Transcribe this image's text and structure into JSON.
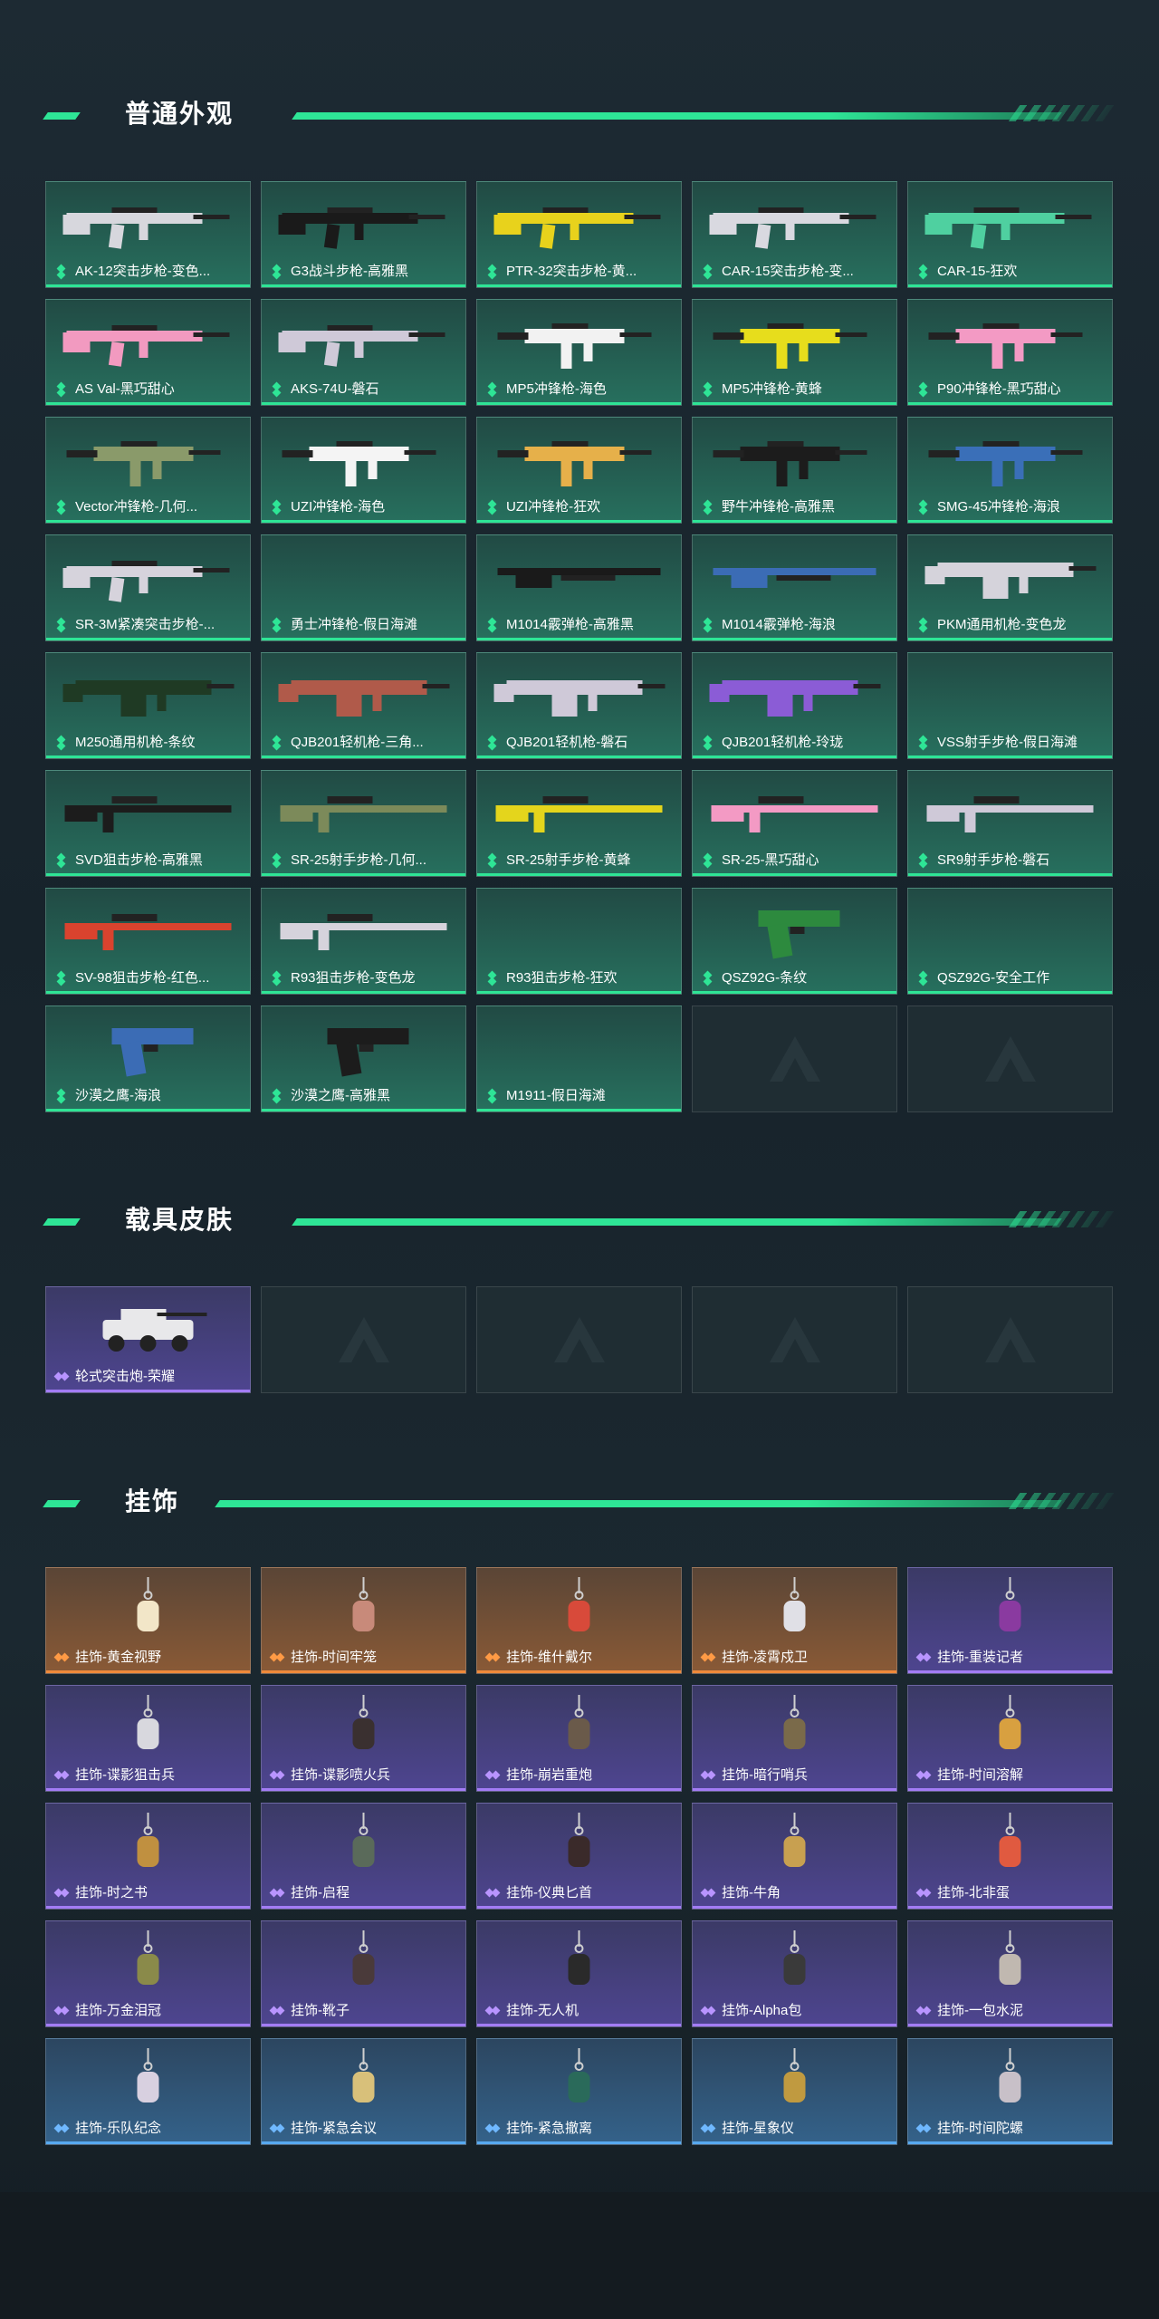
{
  "sections": {
    "weapons": {
      "title": "普通外观",
      "items": [
        {
          "label": "AK-12突击步枪-变色...",
          "quality": "green",
          "icon": "rifle-icon",
          "color": "#d7d7dd"
        },
        {
          "label": "G3战斗步枪-高雅黑",
          "quality": "green",
          "icon": "rifle-icon",
          "color": "#1a1a1a"
        },
        {
          "label": "PTR-32突击步枪-黄...",
          "quality": "green",
          "icon": "rifle-icon",
          "color": "#e8d21c"
        },
        {
          "label": "CAR-15突击步枪-变...",
          "quality": "green",
          "icon": "rifle-icon",
          "color": "#d9d9e0"
        },
        {
          "label": "CAR-15-狂欢",
          "quality": "green",
          "icon": "rifle-icon",
          "color": "#4fd0a0"
        },
        {
          "label": "AS Val-黑巧甜心",
          "quality": "green",
          "icon": "rifle-icon",
          "color": "#f29ac0"
        },
        {
          "label": "AKS-74U-磐石",
          "quality": "green",
          "icon": "rifle-icon",
          "color": "#cfc9d8"
        },
        {
          "label": "MP5冲锋枪-海色",
          "quality": "green",
          "icon": "smg-icon",
          "color": "#f2f2f2"
        },
        {
          "label": "MP5冲锋枪-黄蜂",
          "quality": "green",
          "icon": "smg-icon",
          "color": "#e7dd1c"
        },
        {
          "label": "P90冲锋枪-黑巧甜心",
          "quality": "green",
          "icon": "smg-icon",
          "color": "#f39ac4"
        },
        {
          "label": "Vector冲锋枪-几何...",
          "quality": "green",
          "icon": "smg-icon",
          "color": "#8a9a6a"
        },
        {
          "label": "UZI冲锋枪-海色",
          "quality": "green",
          "icon": "smg-icon",
          "color": "#f4f4f4"
        },
        {
          "label": "UZI冲锋枪-狂欢",
          "quality": "green",
          "icon": "smg-icon",
          "color": "#e6b04a"
        },
        {
          "label": "野牛冲锋枪-高雅黑",
          "quality": "green",
          "icon": "smg-icon",
          "color": "#1c1c1c"
        },
        {
          "label": "SMG-45冲锋枪-海浪",
          "quality": "green",
          "icon": "smg-icon",
          "color": "#3a6fb8"
        },
        {
          "label": "SR-3M紧凑突击步枪-...",
          "quality": "green",
          "icon": "rifle-icon",
          "color": "#d6d3dc"
        },
        {
          "label": "勇士冲锋枪-假日海滩",
          "quality": "green",
          "icon": "smg-icon",
          "color": ""
        },
        {
          "label": "M1014霰弹枪-高雅黑",
          "quality": "green",
          "icon": "shotgun-icon",
          "color": "#1a1a1a"
        },
        {
          "label": "M1014霰弹枪-海浪",
          "quality": "green",
          "icon": "shotgun-icon",
          "color": "#3b6cb5"
        },
        {
          "label": "PKM通用机枪-变色龙",
          "quality": "green",
          "icon": "machinegun-icon",
          "color": "#d5d3db"
        },
        {
          "label": "M250通用机枪-条纹",
          "quality": "green",
          "icon": "machinegun-icon",
          "color": "#1f3a24"
        },
        {
          "label": "QJB201轻机枪-三角...",
          "quality": "green",
          "icon": "machinegun-icon",
          "color": "#b05a4a"
        },
        {
          "label": "QJB201轻机枪-磐石",
          "quality": "green",
          "icon": "machinegun-icon",
          "color": "#cfc9d8"
        },
        {
          "label": "QJB201轻机枪-玲珑",
          "quality": "green",
          "icon": "machinegun-icon",
          "color": "#8b5cd6"
        },
        {
          "label": "VSS射手步枪-假日海滩",
          "quality": "green",
          "icon": "sniper-icon",
          "color": ""
        },
        {
          "label": "SVD狙击步枪-高雅黑",
          "quality": "green",
          "icon": "sniper-icon",
          "color": "#1c1c1c"
        },
        {
          "label": "SR-25射手步枪-几何...",
          "quality": "green",
          "icon": "sniper-icon",
          "color": "#7c8a5a"
        },
        {
          "label": "SR-25射手步枪-黄蜂",
          "quality": "green",
          "icon": "sniper-icon",
          "color": "#e4d51c"
        },
        {
          "label": "SR-25-黑巧甜心",
          "quality": "green",
          "icon": "sniper-icon",
          "color": "#f39ac4"
        },
        {
          "label": "SR9射手步枪-磐石",
          "quality": "green",
          "icon": "sniper-icon",
          "color": "#cfc9d8"
        },
        {
          "label": "SV-98狙击步枪-红色...",
          "quality": "green",
          "icon": "sniper-icon",
          "color": "#d9432e"
        },
        {
          "label": "R93狙击步枪-变色龙",
          "quality": "green",
          "icon": "sniper-icon",
          "color": "#d6d3dc"
        },
        {
          "label": "R93狙击步枪-狂欢",
          "quality": "green",
          "icon": "sniper-icon",
          "color": ""
        },
        {
          "label": "QSZ92G-条纹",
          "quality": "green",
          "icon": "pistol-icon",
          "color": "#2d8a3e"
        },
        {
          "label": "QSZ92G-安全工作",
          "quality": "green",
          "icon": "pistol-icon",
          "color": ""
        },
        {
          "label": "沙漠之鹰-海浪",
          "quality": "green",
          "icon": "pistol-icon",
          "color": "#3b6cb5"
        },
        {
          "label": "沙漠之鹰-高雅黑",
          "quality": "green",
          "icon": "pistol-icon",
          "color": "#1c1c1c"
        },
        {
          "label": "M1911-假日海滩",
          "quality": "green",
          "icon": "pistol-icon",
          "color": ""
        },
        {
          "label": "",
          "quality": "empty",
          "icon": "brand-logo-icon",
          "color": ""
        },
        {
          "label": "",
          "quality": "empty",
          "icon": "brand-logo-icon",
          "color": ""
        }
      ]
    },
    "vehicles": {
      "title": "载具皮肤",
      "items": [
        {
          "label": "轮式突击炮-荣耀",
          "quality": "purple",
          "icon": "vehicle-icon",
          "color": "#e8e8ea"
        },
        {
          "label": "",
          "quality": "empty",
          "icon": "brand-logo-icon",
          "color": ""
        },
        {
          "label": "",
          "quality": "empty",
          "icon": "brand-logo-icon",
          "color": ""
        },
        {
          "label": "",
          "quality": "empty",
          "icon": "brand-logo-icon",
          "color": ""
        },
        {
          "label": "",
          "quality": "empty",
          "icon": "brand-logo-icon",
          "color": ""
        }
      ]
    },
    "charms": {
      "title": "挂饰",
      "items": [
        {
          "label": "挂饰-黄金视野",
          "quality": "orange",
          "icon": "charm-icon",
          "color": "#f2e6c8"
        },
        {
          "label": "挂饰-时间牢笼",
          "quality": "orange",
          "icon": "charm-icon",
          "color": "#c88a7a"
        },
        {
          "label": "挂饰-维什戴尔",
          "quality": "orange",
          "icon": "charm-icon",
          "color": "#d84a3a"
        },
        {
          "label": "挂饰-凌霄戍卫",
          "quality": "orange",
          "icon": "charm-icon",
          "color": "#e0e0e6"
        },
        {
          "label": "挂饰-重装记者",
          "quality": "purple",
          "icon": "charm-icon",
          "color": "#8a3aa0"
        },
        {
          "label": "挂饰-谍影狙击兵",
          "quality": "purple",
          "icon": "charm-icon",
          "color": "#d8d8de"
        },
        {
          "label": "挂饰-谍影喷火兵",
          "quality": "purple",
          "icon": "charm-icon",
          "color": "#3a3030"
        },
        {
          "label": "挂饰-崩岩重炮",
          "quality": "purple",
          "icon": "charm-icon",
          "color": "#6a5a4a"
        },
        {
          "label": "挂饰-暗行哨兵",
          "quality": "purple",
          "icon": "charm-icon",
          "color": "#7a6a4a"
        },
        {
          "label": "挂饰-时间溶解",
          "quality": "purple",
          "icon": "charm-icon",
          "color": "#d8a040"
        },
        {
          "label": "挂饰-时之书",
          "quality": "purple",
          "icon": "charm-icon",
          "color": "#c09040"
        },
        {
          "label": "挂饰-启程",
          "quality": "purple",
          "icon": "charm-icon",
          "color": "#5a6a5a"
        },
        {
          "label": "挂饰-仪典匕首",
          "quality": "purple",
          "icon": "charm-icon",
          "color": "#3a2a2a"
        },
        {
          "label": "挂饰-牛角",
          "quality": "purple",
          "icon": "charm-icon",
          "color": "#c8a050"
        },
        {
          "label": "挂饰-北非蛋",
          "quality": "purple",
          "icon": "charm-icon",
          "color": "#e05a40"
        },
        {
          "label": "挂饰-万金泪冠",
          "quality": "purple",
          "icon": "charm-icon",
          "color": "#8a8a4a"
        },
        {
          "label": "挂饰-靴子",
          "quality": "purple",
          "icon": "charm-icon",
          "color": "#4a3a3a"
        },
        {
          "label": "挂饰-无人机",
          "quality": "purple",
          "icon": "charm-icon",
          "color": "#2a2a2a"
        },
        {
          "label": "挂饰-Alpha包",
          "quality": "purple",
          "icon": "charm-icon",
          "color": "#3a3a3a"
        },
        {
          "label": "挂饰-一包水泥",
          "quality": "purple",
          "icon": "charm-icon",
          "color": "#c0b8b0"
        },
        {
          "label": "挂饰-乐队纪念",
          "quality": "blue",
          "icon": "charm-icon",
          "color": "#d8d0e0"
        },
        {
          "label": "挂饰-紧急会议",
          "quality": "blue",
          "icon": "charm-icon",
          "color": "#d8c07a"
        },
        {
          "label": "挂饰-紧急撤离",
          "quality": "blue",
          "icon": "charm-icon",
          "color": "#2a6a5a"
        },
        {
          "label": "挂饰-星象仪",
          "quality": "blue",
          "icon": "charm-icon",
          "color": "#c09a40"
        },
        {
          "label": "挂饰-时间陀螺",
          "quality": "blue",
          "icon": "charm-icon",
          "color": "#c8c0c8"
        }
      ]
    }
  },
  "colors": {
    "accent": "#2ee596",
    "green_quality": "#2ee596",
    "purple_quality": "#a37cf5",
    "orange_quality": "#f08a3a",
    "blue_quality": "#58a9f0"
  }
}
